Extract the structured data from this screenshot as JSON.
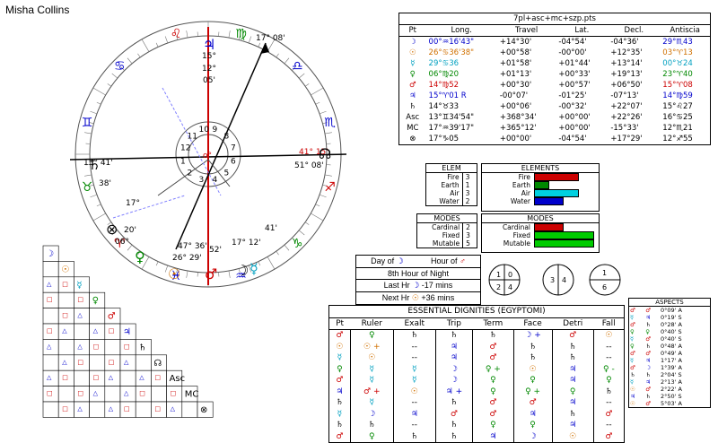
{
  "chart_name": "Misha Collins",
  "colors": {
    "red": "#cc0000",
    "green": "#008800",
    "blue": "#0000cc",
    "cyan": "#00a0c0",
    "orange": "#d07000",
    "magenta": "#a000a0"
  },
  "wheel": {
    "signs": [
      {
        "glyph": "♈",
        "label": "aries-icon",
        "color": "#cc0000"
      },
      {
        "glyph": "♉",
        "label": "taurus-icon",
        "color": "#008800"
      },
      {
        "glyph": "♊",
        "label": "gemini-icon",
        "color": "#0000cc"
      },
      {
        "glyph": "♋",
        "label": "cancer-icon",
        "color": "#0000cc"
      },
      {
        "glyph": "♌",
        "label": "leo-icon",
        "color": "#cc0000"
      },
      {
        "glyph": "♍",
        "label": "virgo-icon",
        "color": "#008800"
      },
      {
        "glyph": "♎",
        "label": "libra-icon",
        "color": "#0000cc"
      },
      {
        "glyph": "♏",
        "label": "scorpio-icon",
        "color": "#0000cc"
      },
      {
        "glyph": "♐",
        "label": "sagittarius-icon",
        "color": "#cc0000"
      },
      {
        "glyph": "♑",
        "label": "capricorn-icon",
        "color": "#008800"
      },
      {
        "glyph": "♒",
        "label": "aquarius-icon",
        "color": "#0000cc"
      },
      {
        "glyph": "♓",
        "label": "pisces-icon",
        "color": "#0000cc"
      }
    ],
    "labels": [
      {
        "t": "15° 41'",
        "c": "#000"
      },
      {
        "t": "41° 15'",
        "c": "#cc0000"
      },
      {
        "t": "51° 08'",
        "c": "#000"
      },
      {
        "t": "17° 08'",
        "c": "#000"
      },
      {
        "t": "15°",
        "c": "#000"
      },
      {
        "t": "12°",
        "c": "#000"
      },
      {
        "t": "05'",
        "c": "#000"
      },
      {
        "t": "47° 36'",
        "c": "#000"
      },
      {
        "t": "26° 29'",
        "c": "#000"
      },
      {
        "t": "52'",
        "c": "#000"
      },
      {
        "t": "17° 12'",
        "c": "#000"
      },
      {
        "t": "41'",
        "c": "#000"
      },
      {
        "t": "38'",
        "c": "#000"
      },
      {
        "t": "06°",
        "c": "#000"
      },
      {
        "t": "20'",
        "c": "#000"
      },
      {
        "t": "17°",
        "c": "#000"
      }
    ],
    "houses": [
      "1",
      "2",
      "3",
      "4",
      "5",
      "6",
      "7",
      "8",
      "9",
      "10",
      "11",
      "12"
    ]
  },
  "planet_table": {
    "title": "7pl+asc+mc+szp.pts",
    "headers": [
      "Pt",
      "Long.",
      "Travel",
      "Lat.",
      "Decl.",
      "Antiscia"
    ],
    "rows": [
      {
        "g": "☽",
        "c": "#0000cc",
        "long": "00°♒16'43\"",
        "travel": "+14°30'",
        "lat": "-04°54'",
        "decl": "-04°36'",
        "ant": "29°♏43"
      },
      {
        "g": "☉",
        "c": "#d07000",
        "long": "26°♋36'38\"",
        "travel": "+00°58'",
        "lat": "-00°00'",
        "decl": "+12°35'",
        "ant": "03°♈13"
      },
      {
        "g": "☿",
        "c": "#00a0c0",
        "long": "29°♋36",
        "travel": "+01°58'",
        "lat": "+01°44'",
        "decl": "+13°14'",
        "ant": "00°♉24"
      },
      {
        "g": "♀",
        "c": "#008800",
        "long": "06°♍20",
        "travel": "+01°13'",
        "lat": "+00°33'",
        "decl": "+19°13'",
        "ant": "23°♈40"
      },
      {
        "g": "♂",
        "c": "#cc0000",
        "long": "14°♍52",
        "travel": "+00°30'",
        "lat": "+00°57'",
        "decl": "+06°50'",
        "ant": "15°♈08"
      },
      {
        "g": "♃",
        "c": "#0000cc",
        "long": "15°♈01 R",
        "travel": "-00°07'",
        "lat": "-01°25'",
        "decl": "-07°13'",
        "ant": "14°♍59"
      },
      {
        "g": "♄",
        "c": "#000",
        "long": "14°♉33",
        "travel": "+00°06'",
        "lat": "-00°32'",
        "decl": "+22°07'",
        "ant": "15°♌27"
      },
      {
        "g": "Asc",
        "c": "#000",
        "long": "13°♊34'54\"",
        "travel": "+368°34'",
        "lat": "+00°00'",
        "decl": "+22°26'",
        "ant": "16°♋25"
      },
      {
        "g": "MC",
        "c": "#000",
        "long": "17°♒39'17\"",
        "travel": "+365°12'",
        "lat": "+00°00'",
        "decl": "-15°33'",
        "ant": "12°♏21"
      },
      {
        "g": "⊗",
        "c": "#000",
        "long": "17°♑05",
        "travel": "+00°00'",
        "lat": "-04°54'",
        "decl": "+17°29'",
        "ant": "12°♐55"
      }
    ]
  },
  "elem_small": {
    "title": "ELEM",
    "rows": [
      {
        "n": "Fire",
        "v": "3"
      },
      {
        "n": "Earth",
        "v": "1"
      },
      {
        "n": "Air",
        "v": "3"
      },
      {
        "n": "Water",
        "v": "2"
      }
    ]
  },
  "elem_bars": {
    "title": "ELEMENTS",
    "rows": [
      {
        "n": "Fire",
        "frac": 0.7,
        "c": "#cc0000"
      },
      {
        "n": "Earth",
        "frac": 0.22,
        "c": "#008800"
      },
      {
        "n": "Air",
        "frac": 0.7,
        "c": "#00d0e0"
      },
      {
        "n": "Water",
        "frac": 0.45,
        "c": "#0000cc"
      }
    ]
  },
  "modes_small": {
    "title": "MODES",
    "rows": [
      {
        "n": "Cardinal",
        "v": "2"
      },
      {
        "n": "Fixed",
        "v": "3"
      },
      {
        "n": "Mutable",
        "v": "5"
      }
    ]
  },
  "modes_bars": {
    "title": "MODES",
    "rows": [
      {
        "n": "Cardinal",
        "frac": 0.45,
        "c": "#cc0000"
      },
      {
        "n": "Fixed",
        "frac": 0.95,
        "c": "#00cc00"
      },
      {
        "n": "Mutable",
        "frac": 0.95,
        "c": "#00cc00"
      }
    ]
  },
  "hour": {
    "day_label": "Day of",
    "day_ruler": "☽",
    "hour_label": "Hour of",
    "hour_ruler": "♂",
    "night": "8th Hour of Night",
    "last_label": "Last Hr",
    "last_val": "-17 mins",
    "next_label": "Next Hr",
    "next_val": "+36 mins"
  },
  "circles": [
    [
      "1",
      "0",
      "2",
      "4"
    ],
    [
      "3",
      "4"
    ],
    [
      "1",
      "6"
    ]
  ],
  "dignities": {
    "title": "ESSENTIAL DIGNITIES (EGYPTOMI)",
    "headers": [
      "Pt",
      "Ruler",
      "Exalt",
      "Trip",
      "Term",
      "Face",
      "Detri",
      "Fall"
    ],
    "rows": [
      [
        "♂",
        "♀",
        "♄",
        "♄",
        "♄",
        "☽ +",
        "♂",
        "☉"
      ],
      [
        "☉",
        "☉ +",
        "--",
        "♃",
        "♂",
        "♄",
        "♄",
        "--"
      ],
      [
        "☿",
        "☉",
        "--",
        "♃",
        "♂",
        "♄",
        "♄",
        "--"
      ],
      [
        "♀",
        "☿",
        "☿",
        "☽",
        "♀ +",
        "☉",
        "♃",
        "♀ -"
      ],
      [
        "♂",
        "☿",
        "☿",
        "☽",
        "♀",
        "♀",
        "♃",
        "♀"
      ],
      [
        "♃",
        "♂ +",
        "☉",
        "♃ +",
        "♀",
        "♀ +",
        "♀",
        "♄"
      ],
      [
        "♄",
        "☿",
        "--",
        "♄",
        "♂",
        "♂",
        "♃",
        "--"
      ],
      [
        "☿",
        "☽",
        "♃",
        "♂",
        "♂",
        "♃",
        "♄",
        "♂"
      ],
      [
        "♄",
        "♄",
        "--",
        "♄",
        "♀",
        "♀",
        "♃",
        "--"
      ],
      [
        "♂",
        "♀",
        "♄",
        "♄",
        "♃",
        "☽",
        "☉",
        "♂"
      ]
    ]
  },
  "aspects": {
    "title": "ASPECTS",
    "rows": [
      "0°09' A",
      "0°19' S",
      "0°28' A",
      "0°40' S",
      "0°40' S",
      "0°48' A",
      "0°49' A",
      "1°17' A",
      "1°39' A",
      "2°04' S",
      "2°13' A",
      "2°22' A",
      "2°50' S",
      "5°03' A"
    ]
  },
  "grid_glyphs": [
    "☽",
    "☉",
    "☿",
    "♀",
    "♂",
    "♃",
    "♄",
    "☊",
    "Asc",
    "MC",
    "⊗"
  ]
}
